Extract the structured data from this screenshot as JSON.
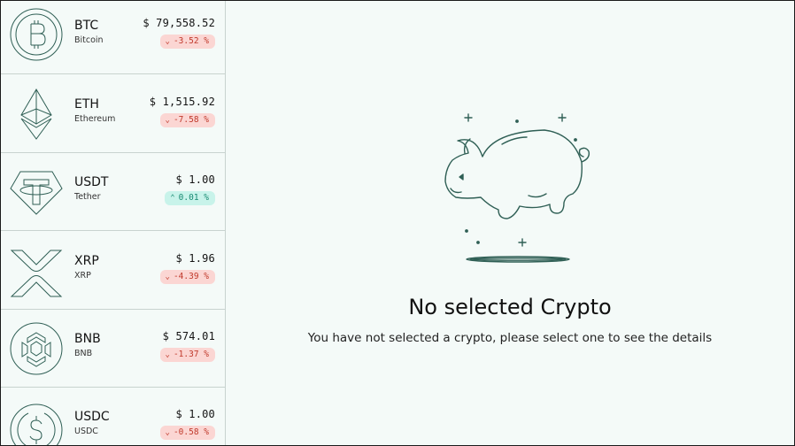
{
  "coins": [
    {
      "symbol": "BTC",
      "name": "Bitcoin",
      "price": "$ 79,558.52",
      "change": "-3.52 %",
      "direction": "down",
      "icon": "bitcoin-icon"
    },
    {
      "symbol": "ETH",
      "name": "Ethereum",
      "price": "$ 1,515.92",
      "change": "-7.58 %",
      "direction": "down",
      "icon": "ethereum-icon"
    },
    {
      "symbol": "USDT",
      "name": "Tether",
      "price": "$ 1.00",
      "change": "0.01 %",
      "direction": "up",
      "icon": "tether-icon"
    },
    {
      "symbol": "XRP",
      "name": "XRP",
      "price": "$ 1.96",
      "change": "-4.39 %",
      "direction": "down",
      "icon": "xrp-icon"
    },
    {
      "symbol": "BNB",
      "name": "BNB",
      "price": "$ 574.01",
      "change": "-1.37 %",
      "direction": "down",
      "icon": "bnb-icon"
    },
    {
      "symbol": "USDC",
      "name": "USDC",
      "price": "$ 1.00",
      "change": "-0.58 %",
      "direction": "down",
      "icon": "usdc-icon"
    }
  ],
  "empty_state": {
    "title": "No selected Crypto",
    "message": "You have not selected a crypto, please select one to see the details",
    "illustration": "piggy-bank-icon"
  },
  "colors": {
    "background": "#f4faf8",
    "icon_stroke": "#2f5f55",
    "negative_bg": "#fbd6d3",
    "negative_text": "#c0392b",
    "positive_bg": "#c8f3ea",
    "positive_text": "#198a72",
    "divider": "#c8d3cf"
  }
}
